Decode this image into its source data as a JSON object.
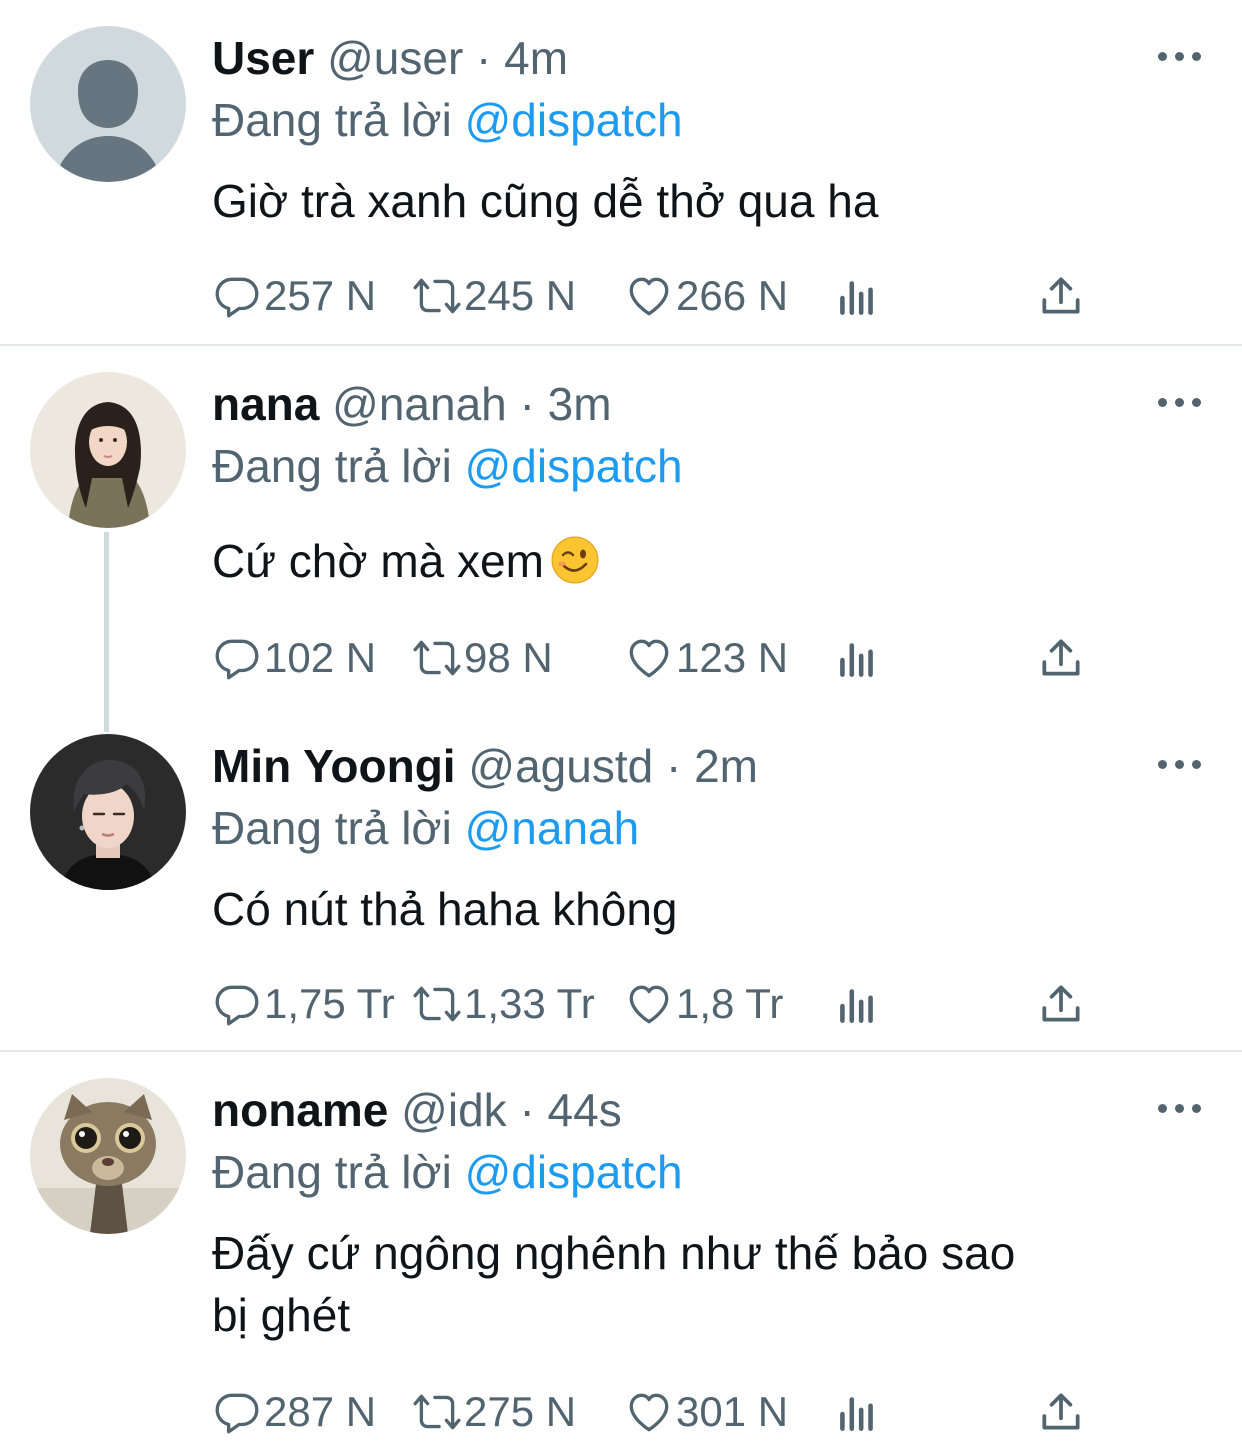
{
  "tweets": [
    {
      "name": "User",
      "handle": "@user",
      "time": "4m",
      "reply_prefix": "Đang trả lời",
      "reply_to": "@dispatch",
      "text": [
        "Giờ trà xanh cũng dễ thở qua ha"
      ],
      "emoji": "",
      "stats": {
        "replies": "257 N",
        "retweets": "245 N",
        "likes": "266 N"
      },
      "avatar": "default-avatar"
    },
    {
      "name": "nana",
      "handle": "@nanah",
      "time": "3m",
      "reply_prefix": "Đang trả lời",
      "reply_to": "@dispatch",
      "text": [
        "Cứ chờ mà xem"
      ],
      "emoji": "winking-face",
      "stats": {
        "replies": "102 N",
        "retweets": "98 N",
        "likes": "123 N"
      },
      "avatar": "girl-photo"
    },
    {
      "name": "Min Yoongi",
      "handle": "@agustd",
      "time": "2m",
      "reply_prefix": "Đang trả lời",
      "reply_to": "@nanah",
      "text": [
        "Có nút thả haha không"
      ],
      "emoji": "",
      "stats": {
        "replies": "1,75 Tr",
        "retweets": "1,33 Tr",
        "likes": "1,8 Tr"
      },
      "avatar": "man-photo"
    },
    {
      "name": "noname",
      "handle": "@idk",
      "time": "44s",
      "reply_prefix": "Đang trả lời",
      "reply_to": "@dispatch",
      "text": [
        "Đấy cứ ngông nghênh như thế bảo sao",
        "bị ghét"
      ],
      "emoji": "",
      "stats": {
        "replies": "287 N",
        "retweets": "275 N",
        "likes": "301 N"
      },
      "avatar": "cat-photo"
    }
  ],
  "separator": "·",
  "icons": {
    "reply": "reply-icon",
    "retweet": "retweet-icon",
    "like": "heart-icon",
    "views": "views-icon",
    "share": "share-icon",
    "more": "more-icon"
  },
  "colors": {
    "text": "#0f1419",
    "muted": "#536471",
    "link": "#1d9bf0",
    "divider": "#e6e9ec"
  }
}
